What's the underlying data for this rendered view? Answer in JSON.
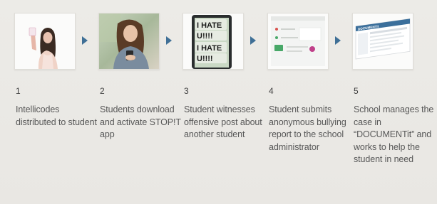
{
  "colors": {
    "background": "#eae8e4",
    "arrow": "#3f6f96",
    "text": "#585858",
    "number": "#3e3e3e"
  },
  "steps": [
    {
      "number": "1",
      "description": "Intellicodes distributed to student",
      "image": "girl-holding-card-photo"
    },
    {
      "number": "2",
      "description": "Students download and activate STOP!T app",
      "image": "girl-using-phone-photo"
    },
    {
      "number": "3",
      "description": "Student witnesses offensive post about another student",
      "image": "phone-screen-photo",
      "image_text": [
        "I HATE",
        "U!!!!",
        "I HATE",
        "U!!!!"
      ]
    },
    {
      "number": "4",
      "description": "Student submits anonymous bullying report to the school administrator",
      "image": "app-report-screen-photo"
    },
    {
      "number": "5",
      "description": "School manages the case in “DOCUMENTit” and works to help the student in need",
      "image": "documentit-dashboard-screen",
      "image_text": [
        "DOCUMENTit"
      ]
    }
  ]
}
